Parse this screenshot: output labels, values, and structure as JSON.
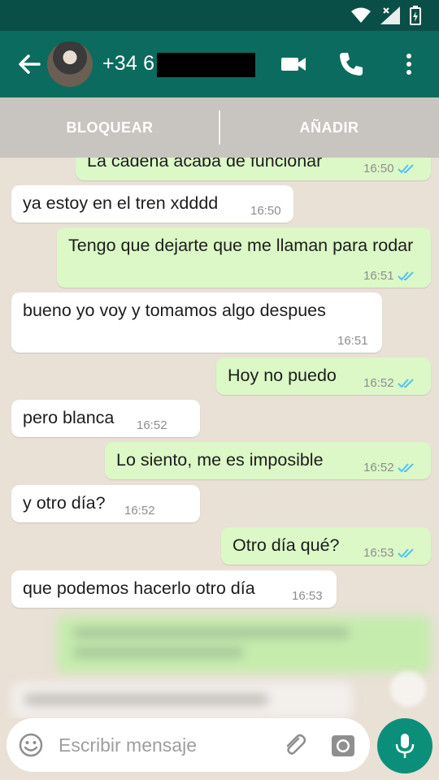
{
  "header": {
    "contact_name": "+34 6",
    "back_icon": "arrow-left-icon",
    "video_icon": "video-camera-icon",
    "call_icon": "phone-icon",
    "menu_icon": "more-vert-icon"
  },
  "actions": {
    "block_label": "BLOQUEAR",
    "add_label": "AÑADIR"
  },
  "messages": [
    {
      "dir": "out",
      "text": "La cadena acaba de funcionar",
      "time": "16:50",
      "read": true
    },
    {
      "dir": "in",
      "text": "ya estoy en el tren xdddd",
      "time": "16:50"
    },
    {
      "dir": "out",
      "text": "Tengo que dejarte que me llaman para rodar",
      "time": "16:51",
      "read": true
    },
    {
      "dir": "in",
      "text": "bueno yo voy y tomamos algo despues",
      "time": "16:51"
    },
    {
      "dir": "out",
      "text": "Hoy no puedo",
      "time": "16:52",
      "read": true
    },
    {
      "dir": "in",
      "text": "pero blanca",
      "time": "16:52"
    },
    {
      "dir": "out",
      "text": "Lo siento, me es imposible",
      "time": "16:52",
      "read": true
    },
    {
      "dir": "in",
      "text": "y otro día?",
      "time": "16:52"
    },
    {
      "dir": "out",
      "text": "Otro día qué?",
      "time": "16:53",
      "read": true
    },
    {
      "dir": "in",
      "text": "que podemos hacerlo otro día",
      "time": "16:53"
    }
  ],
  "composer": {
    "placeholder": "Escribir mensaje"
  },
  "colors": {
    "toolbar": "#0b6b5e",
    "statusbar": "#0a4f47",
    "outgoing_bubble": "#dbf8c6",
    "incoming_bubble": "#ffffff",
    "read_ticks": "#4fc3f7",
    "mic_button": "#0b8f7b"
  }
}
